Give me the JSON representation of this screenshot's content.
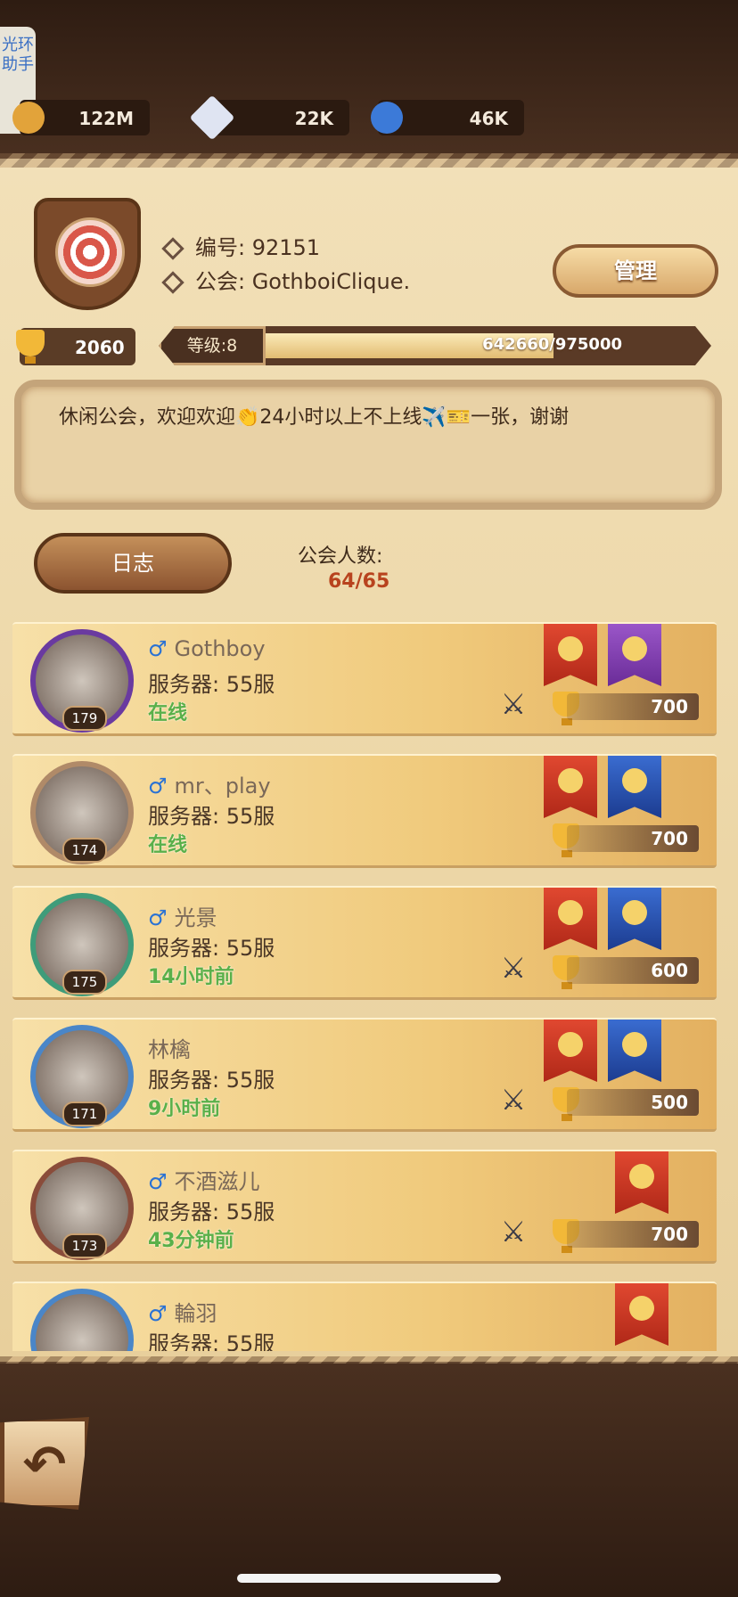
{
  "side_tab": {
    "label": "光环助手"
  },
  "resources": [
    {
      "name": "gold",
      "value": "122M",
      "icon": "gold-coin-icon",
      "color": "#e2a33a"
    },
    {
      "name": "diamond",
      "value": "22K",
      "icon": "diamond-icon",
      "color": "#dfe4f2"
    },
    {
      "name": "blue-orb",
      "value": "46K",
      "icon": "blue-orb-icon",
      "color": "#3c7ad8"
    }
  ],
  "guild": {
    "id_label": "编号: 92151",
    "name_label": "公会: GothboiClique.",
    "manage_label": "管理",
    "trophies": "2060",
    "level_label": "等级:8",
    "exp_text": "642660/975000",
    "exp_progress": 0.659,
    "motto": "休闲公会，欢迎欢迎👏24小时以上不上线✈️🎫一张，谢谢",
    "log_label": "日志",
    "members_label": "公会人数:",
    "members_count": "64/65"
  },
  "members": [
    {
      "name": "Gothboy",
      "male": true,
      "server": "服务器: 55服",
      "status": "在线",
      "level": "179",
      "trophies": "700",
      "swords": true,
      "banners": [
        "red",
        "purple"
      ],
      "frame_color": "#6a3aa0"
    },
    {
      "name": "mr、play",
      "male": true,
      "server": "服务器: 55服",
      "status": "在线",
      "level": "174",
      "trophies": "700",
      "swords": false,
      "banners": [
        "red",
        "blue"
      ],
      "frame_color": "#b08a68"
    },
    {
      "name": "光景",
      "male": true,
      "server": "服务器: 55服",
      "status": "14小时前",
      "level": "175",
      "trophies": "600",
      "swords": true,
      "banners": [
        "red",
        "blue"
      ],
      "frame_color": "#3f9c7a"
    },
    {
      "name": "林檎",
      "male": false,
      "server": "服务器: 55服",
      "status": "9小时前",
      "level": "171",
      "trophies": "500",
      "swords": true,
      "banners": [
        "red",
        "blue"
      ],
      "frame_color": "#4a86c8"
    },
    {
      "name": "不酒滋儿",
      "male": true,
      "server": "服务器: 55服",
      "status": "43分钟前",
      "level": "173",
      "trophies": "700",
      "swords": true,
      "banners": [
        "red"
      ],
      "frame_color": "#8a4c3a"
    },
    {
      "name": "輪羽",
      "male": true,
      "server": "服务器: 55服",
      "status": "",
      "level": "",
      "trophies": "",
      "swords": true,
      "banners": [
        "red"
      ],
      "frame_color": "#4a86c8"
    }
  ],
  "male_symbol": "♂",
  "back_label": "↶"
}
